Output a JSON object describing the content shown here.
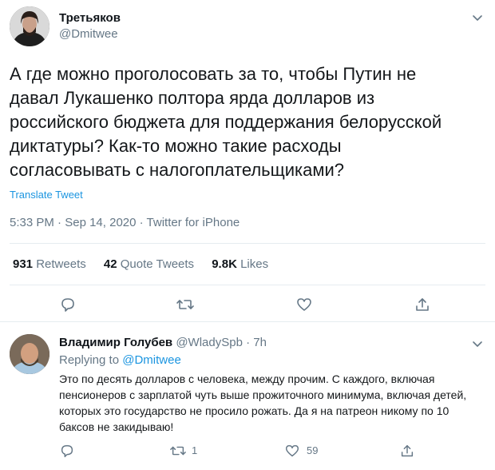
{
  "tweet": {
    "author_name": "Третьяков",
    "author_handle": "@Dmitwee",
    "text": "А где можно проголосовать за то, чтобы Путин не давал Лукашенко полтора ярда долларов из российского бюджета для поддержания белорусской диктатуры? Как-то можно такие расходы согласовывать с налогоплательщиками?",
    "translate_label": "Translate Tweet",
    "time": "5:33 PM",
    "dot1": "·",
    "date": "Sep 14, 2020",
    "dot2": "·",
    "source": "Twitter for iPhone",
    "stats": {
      "retweets_value": "931",
      "retweets_label": "Retweets",
      "quotes_value": "42",
      "quotes_label": "Quote Tweets",
      "likes_value": "9.8K",
      "likes_label": "Likes"
    }
  },
  "reply": {
    "author_name": "Владимир Голубев",
    "author_handle": "@WladySpb",
    "time_sep": "·",
    "time": "7h",
    "replying_to_label": "Replying to",
    "replying_to_handle": "@Dmitwee",
    "text": "Это по десять долларов с человека, между прочим. С каждого, включая пенсионеров с зарплатой чуть выше прожиточного минимума, включая детей, которых это государство не просило рожать. Да я на патреон никому по 10 баксов не закидываю!",
    "retweet_count": "1",
    "like_count": "59"
  },
  "colors": {
    "text": "#0f1419",
    "muted": "#657786",
    "link": "#1b95e0",
    "divider": "#e6ecf0"
  }
}
